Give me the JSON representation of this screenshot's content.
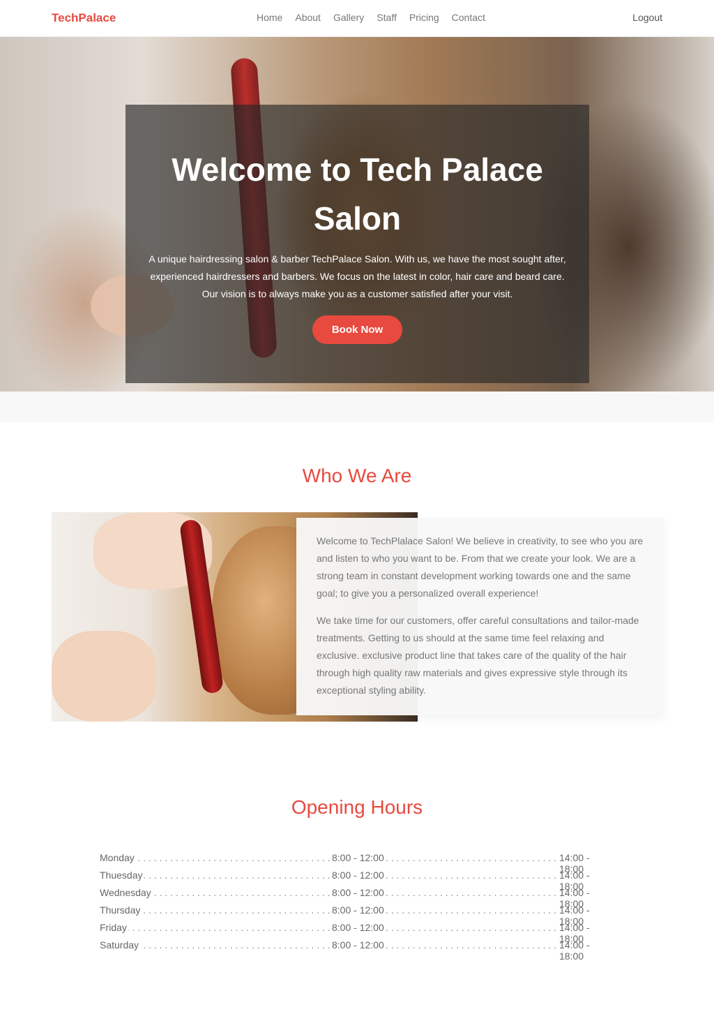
{
  "navbar": {
    "brand": "TechPalace",
    "links": [
      "Home",
      "About",
      "Gallery",
      "Staff",
      "Pricing",
      "Contact"
    ],
    "logout": "Logout"
  },
  "hero": {
    "title": "Welcome to Tech Palace Salon",
    "text": "A unique hairdressing salon & barber TechPalace Salon. With us, we have the most sought after, experienced hairdressers and barbers. We focus on the latest in color, hair care and beard care. Our vision is to always make you as a customer satisfied after your visit.",
    "button": "Book Now"
  },
  "who": {
    "title": "Who We Are",
    "paragraphs": [
      "Welcome to TechPlalace Salon! We believe in creativity, to see who you are and listen to who you want to be. From that we create your look. We are a strong team in constant development working towards one and the same goal; to give you a personalized overall experience!",
      "We take time for our customers, offer careful consultations and tailor-made treatments. Getting to us should at the same time feel relaxing and exclusive. exclusive product line that takes care of the quality of the hair through high quality raw materials and gives expressive style through its exceptional styling ability."
    ]
  },
  "hours": {
    "title": "Opening Hours",
    "rows": [
      {
        "day": "Monday",
        "morning": "8:00 - 12:00",
        "afternoon": "14:00 - 18:00"
      },
      {
        "day": "Thuesday",
        "morning": "8:00 - 12:00",
        "afternoon": "14:00 - 18:00"
      },
      {
        "day": "Wednesday",
        "morning": "8:00 - 12:00",
        "afternoon": "14:00 - 18:00"
      },
      {
        "day": "Thursday",
        "morning": "8:00 - 12:00",
        "afternoon": "14:00 - 18:00"
      },
      {
        "day": "Friday",
        "morning": "8:00 - 12:00",
        "afternoon": "14:00 - 18:00"
      },
      {
        "day": "Saturday",
        "morning": "8:00 - 12:00",
        "afternoon": "14:00 - 18:00"
      }
    ]
  },
  "colors": {
    "accent": "#e84a3f",
    "overlay": "#282828"
  }
}
